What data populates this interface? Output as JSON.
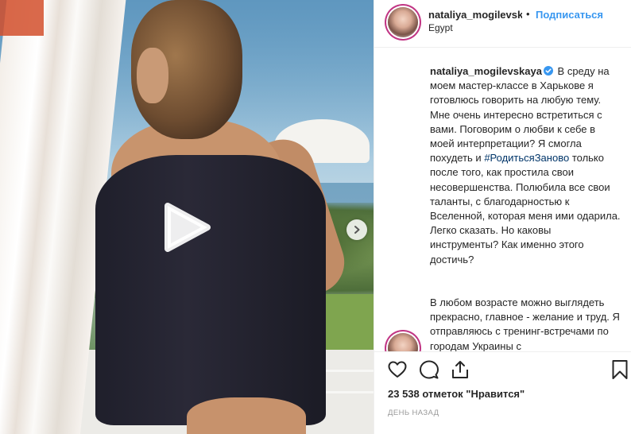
{
  "post": {
    "username": "nataliya_mogilevsk",
    "separator": "•",
    "follow_label": "Подписаться",
    "location": "Egypt",
    "caption": {
      "username": "nataliya_mogilevskaya",
      "text_before_hashtag": "В среду на моем мастер-классе в Харькове я готовлюсь говорить на любую тему. Мне очень интересно встретиться с вами. Поговорим о любви к себе в моей интерпретации? Я смогла похудеть и",
      "hashtag": "#РодитьсяЗаново",
      "text_after_hashtag": "только после того, как простила свои несовершенства. Полюбила все свои таланты, с благодарностью к Вселенной, которая меня ими одарила. Легко сказать. Но каковы инструменты? Как именно этого достичь?"
    },
    "comment2_text": "В любом возрасте можно выглядеть прекрасно, главное - желание и труд. Я отправляюсь с тренинг-встречами по городам Украины с",
    "likes": "23 538 отметок \"Нравится\"",
    "timestamp": "ДЕНЬ НАЗАД"
  },
  "icons": {
    "play": "play-icon",
    "next": "chevron-right-icon",
    "like": "heart-icon",
    "comment": "comment-icon",
    "share": "share-icon",
    "save": "bookmark-icon",
    "verified": "verified-badge-icon"
  },
  "colors": {
    "link": "#3897f0",
    "hashtag": "#003569",
    "text": "#262626",
    "muted": "#999999",
    "verified": "#3897f0"
  }
}
